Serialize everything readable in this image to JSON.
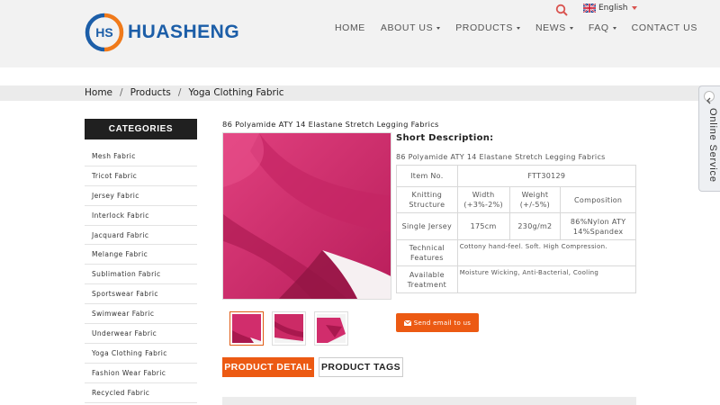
{
  "brand": {
    "name": "HUASHENG",
    "logo_letters": "HS",
    "primary_color": "#1c5ea8",
    "accent_color": "#f07a1a"
  },
  "header": {
    "language": "English",
    "nav": [
      {
        "label": "HOME",
        "dropdown": false
      },
      {
        "label": "ABOUT US",
        "dropdown": true
      },
      {
        "label": "PRODUCTS",
        "dropdown": true
      },
      {
        "label": "NEWS",
        "dropdown": true
      },
      {
        "label": "FAQ",
        "dropdown": true
      },
      {
        "label": "CONTACT US",
        "dropdown": false
      }
    ]
  },
  "breadcrumb": [
    "Home",
    "Products",
    "Yoga Clothing Fabric"
  ],
  "sidebar": {
    "title": "CATEGORIES",
    "items": [
      "Mesh Fabric",
      "Tricot Fabric",
      "Jersey Fabric",
      "Interlock Fabric",
      "Jacquard Fabric",
      "Melange Fabric",
      "Sublimation Fabric",
      "Sportswear Fabric",
      "Swimwear Fabric",
      "Underwear Fabric",
      "Yoga Clothing Fabric",
      "Fashion Wear Fabric",
      "Recycled Fabric"
    ]
  },
  "product": {
    "title": "86 Polyamide ATY 14 Elastane Stretch Legging Fabrics",
    "fabric_color": "#d12d6c",
    "short_desc_title": "Short Description:",
    "short_desc_text": "86 Polyamide ATY 14 Elastane Stretch Legging Fabrics",
    "spec": {
      "item_no_label": "Item No.",
      "item_no_value": "FTT30129",
      "knitting_label": "Knitting Structure",
      "width_label": "Width (+3%-2%)",
      "weight_label": "Weight (+/-5%)",
      "composition_label": "Composition",
      "knitting_value": "Single Jersey",
      "width_value": "175cm",
      "weight_value": "230g/m2",
      "composition_value": "86%Nylon ATY 14%Spandex",
      "technical_label": "Technical Features",
      "technical_value": "Cottony hand-feel. Soft.  High Compression.",
      "treatment_label": "Available Treatment",
      "treatment_value": "Moisture Wicking, Anti-Bacterial, Cooling"
    },
    "email_button": "Send email to us",
    "tabs": [
      "PRODUCT DETAIL",
      "PRODUCT TAGS"
    ]
  },
  "online_service": "Online Service"
}
